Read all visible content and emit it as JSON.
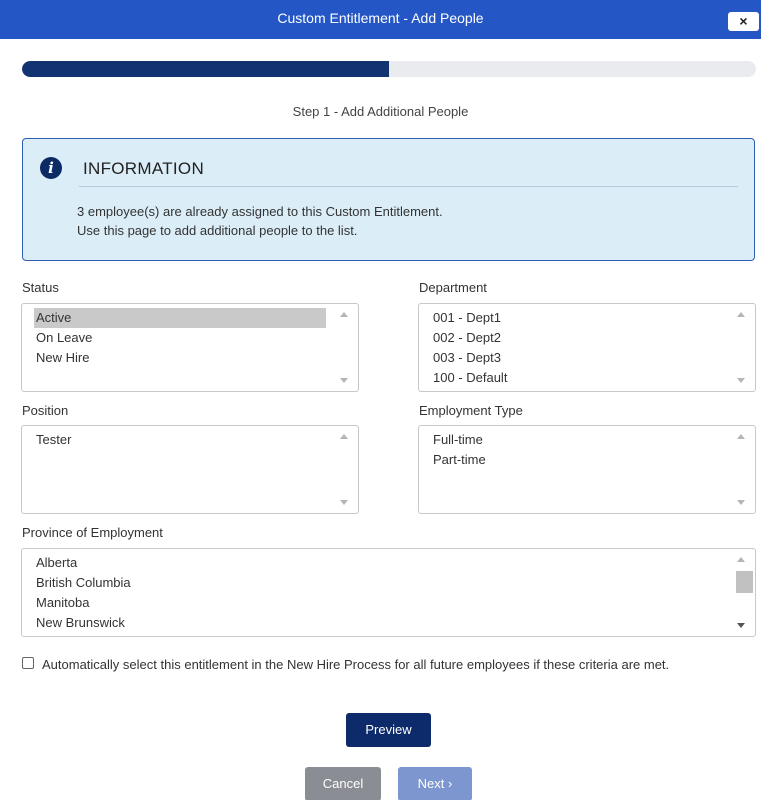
{
  "dialog": {
    "title": "Custom Entitlement - Add People",
    "close_label": "×"
  },
  "progress": {
    "fraction": 0.5
  },
  "step": {
    "label": "Step 1 - Add Additional People"
  },
  "info": {
    "heading": "INFORMATION",
    "line1": "3 employee(s) are already assigned to this Custom Entitlement.",
    "line2": "Use this page to add additional people to the list."
  },
  "status": {
    "label": "Status",
    "items": [
      "Active",
      "On Leave",
      "New Hire"
    ],
    "selected": "Active"
  },
  "department": {
    "label": "Department",
    "items": [
      "001 - Dept1",
      "002 - Dept2",
      "003 - Dept3",
      "100 - Default"
    ]
  },
  "position": {
    "label": "Position",
    "items": [
      "Tester"
    ]
  },
  "employment_type": {
    "label": "Employment Type",
    "items": [
      "Full-time",
      "Part-time"
    ]
  },
  "province": {
    "label": "Province of Employment",
    "items": [
      "Alberta",
      "British Columbia",
      "Manitoba",
      "New Brunswick"
    ]
  },
  "auto_select": {
    "label": "Automatically select this entitlement in the New Hire Process for all future employees if these criteria are met.",
    "checked": false
  },
  "buttons": {
    "preview": "Preview",
    "cancel": "Cancel",
    "next": "Next ›"
  },
  "colors": {
    "titlebar": "#2457c5",
    "primary": "#0d2a6b",
    "info_bg": "#dbedf7",
    "disabled_next": "#7e96cf",
    "cancel": "#8a8d93"
  }
}
